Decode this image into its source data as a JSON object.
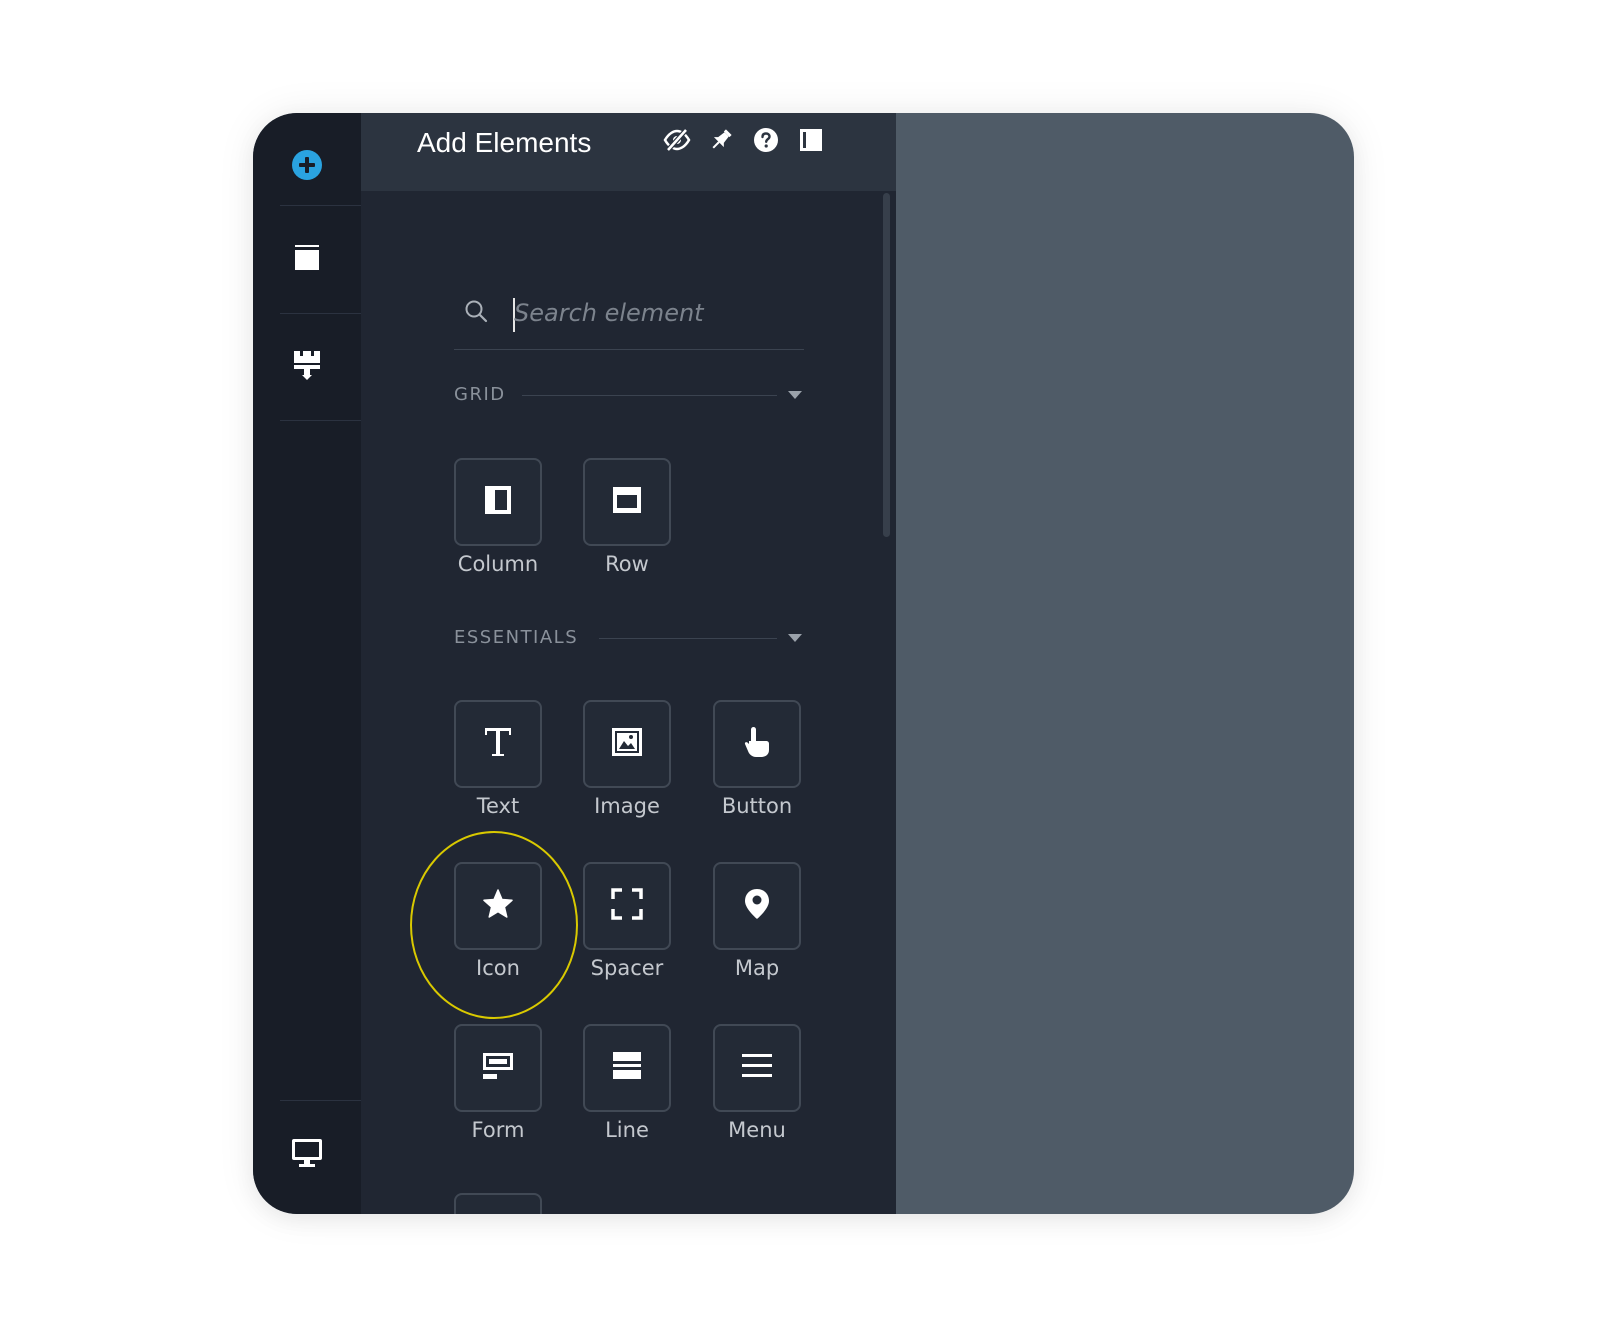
{
  "panel": {
    "title": "Add Elements",
    "header_icons": [
      "eye-off-icon",
      "pin-icon",
      "help-icon",
      "sidebar-toggle-icon"
    ]
  },
  "rail": {
    "items": [
      "add-icon",
      "pages-icon",
      "paint-roller-icon"
    ],
    "bottom_item": "desktop-icon"
  },
  "search": {
    "placeholder": "Search element",
    "value": ""
  },
  "sections": [
    {
      "label": "GRID",
      "items": [
        {
          "label": "Column",
          "icon": "column-icon"
        },
        {
          "label": "Row",
          "icon": "row-icon"
        }
      ]
    },
    {
      "label": "ESSENTIALS",
      "items": [
        {
          "label": "Text",
          "icon": "text-icon"
        },
        {
          "label": "Image",
          "icon": "image-icon"
        },
        {
          "label": "Button",
          "icon": "pointer-hand-icon"
        },
        {
          "label": "Icon",
          "icon": "star-icon"
        },
        {
          "label": "Spacer",
          "icon": "spacer-icon"
        },
        {
          "label": "Map",
          "icon": "map-pin-icon"
        },
        {
          "label": "Form",
          "icon": "form-icon"
        },
        {
          "label": "Line",
          "icon": "line-icon"
        },
        {
          "label": "Menu",
          "icon": "menu-icon"
        }
      ]
    }
  ],
  "colors": {
    "rail_bg": "#181d27",
    "panel_bg": "#202632",
    "header_bg": "#2c3440",
    "canvas_bg": "#4f5b67",
    "accent": "#2aa3e0",
    "highlight": "#d9c900"
  }
}
